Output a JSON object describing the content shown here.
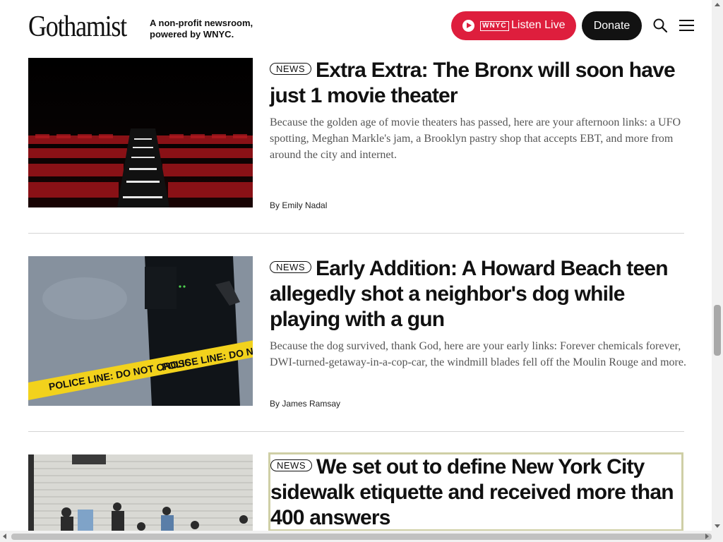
{
  "header": {
    "logo": "Gothamist",
    "tagline_line1": "A non-profit newsroom,",
    "tagline_line2": "powered by WNYC.",
    "listen_live_label": "Listen Live",
    "wnyc_badge": "WNYC",
    "donate_label": "Donate"
  },
  "articles": [
    {
      "tag": "NEWS",
      "headline": "Extra Extra: The Bronx will soon have just 1 movie theater",
      "summary": "Because the golden age of movie theaters has passed, here are your afternoon links: a UFO spotting, Meghan Markle's jam, a Brooklyn pastry shop that accepts EBT, and more from around the city and internet.",
      "byline": "By Emily Nadal"
    },
    {
      "tag": "NEWS",
      "headline": "Early Addition: A Howard Beach teen allegedly shot a neighbor's dog while playing with a gun",
      "summary": "Because the dog survived, thank God, here are your early links: Forever chemicals forever, DWI-turned-getaway-in-a-cop-car, the windmill blades fell off the Moulin Rouge and more.",
      "byline": "By James Ramsay",
      "image_text": "POLICE LINE: DO NOT CROSS"
    },
    {
      "tag": "NEWS",
      "headline": "We set out to define New York City sidewalk etiquette and received more than 400 answers"
    }
  ],
  "colors": {
    "brand_red": "#de1e3d",
    "donate_black": "#121212",
    "focus_outline": "#cfcfa6"
  }
}
